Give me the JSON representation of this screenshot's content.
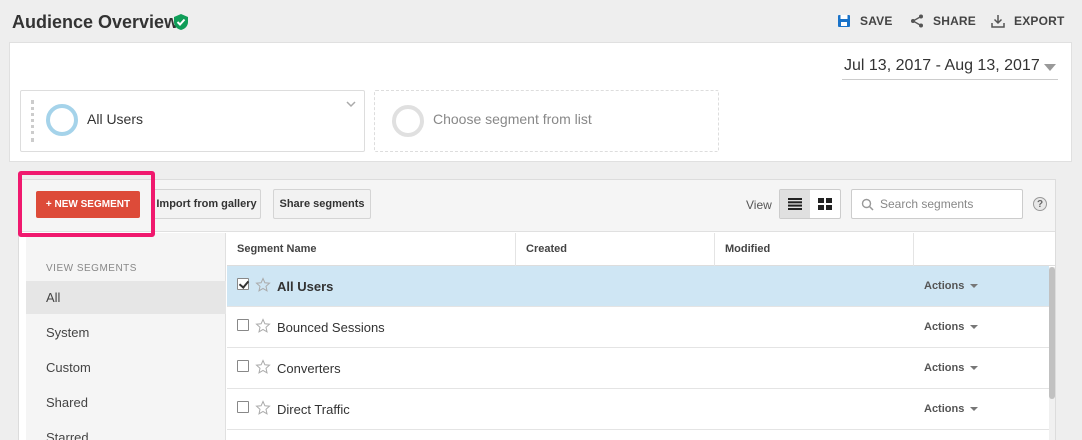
{
  "header": {
    "title": "Audience Overview",
    "save_label": "SAVE",
    "share_label": "SHARE",
    "export_label": "EXPORT"
  },
  "date_range": "Jul 13, 2017 - Aug 13, 2017",
  "segments_bar": {
    "active_segment": "All Users",
    "empty_slot": "Choose segment from list"
  },
  "toolbar": {
    "new_segment": "+ NEW SEGMENT",
    "import": "Import from gallery",
    "share_segments": "Share segments",
    "view_label": "View",
    "search_placeholder": "Search segments",
    "help": "?"
  },
  "sidebar": {
    "heading": "VIEW SEGMENTS",
    "items": [
      {
        "label": "All",
        "active": true
      },
      {
        "label": "System"
      },
      {
        "label": "Custom"
      },
      {
        "label": "Shared"
      },
      {
        "label": "Starred"
      }
    ]
  },
  "table": {
    "columns": [
      "Segment Name",
      "Created",
      "Modified"
    ],
    "rows": [
      {
        "name": "All Users",
        "checked": true,
        "action": "Actions"
      },
      {
        "name": "Bounced Sessions",
        "checked": false,
        "action": "Actions"
      },
      {
        "name": "Converters",
        "checked": false,
        "action": "Actions"
      },
      {
        "name": "Direct Traffic",
        "checked": false,
        "action": "Actions"
      }
    ]
  },
  "colors": {
    "accent_red": "#dd4b39",
    "highlight_pink": "#f0196e",
    "selected_row": "#cfe6f4",
    "verified_green": "#0f9d58"
  }
}
